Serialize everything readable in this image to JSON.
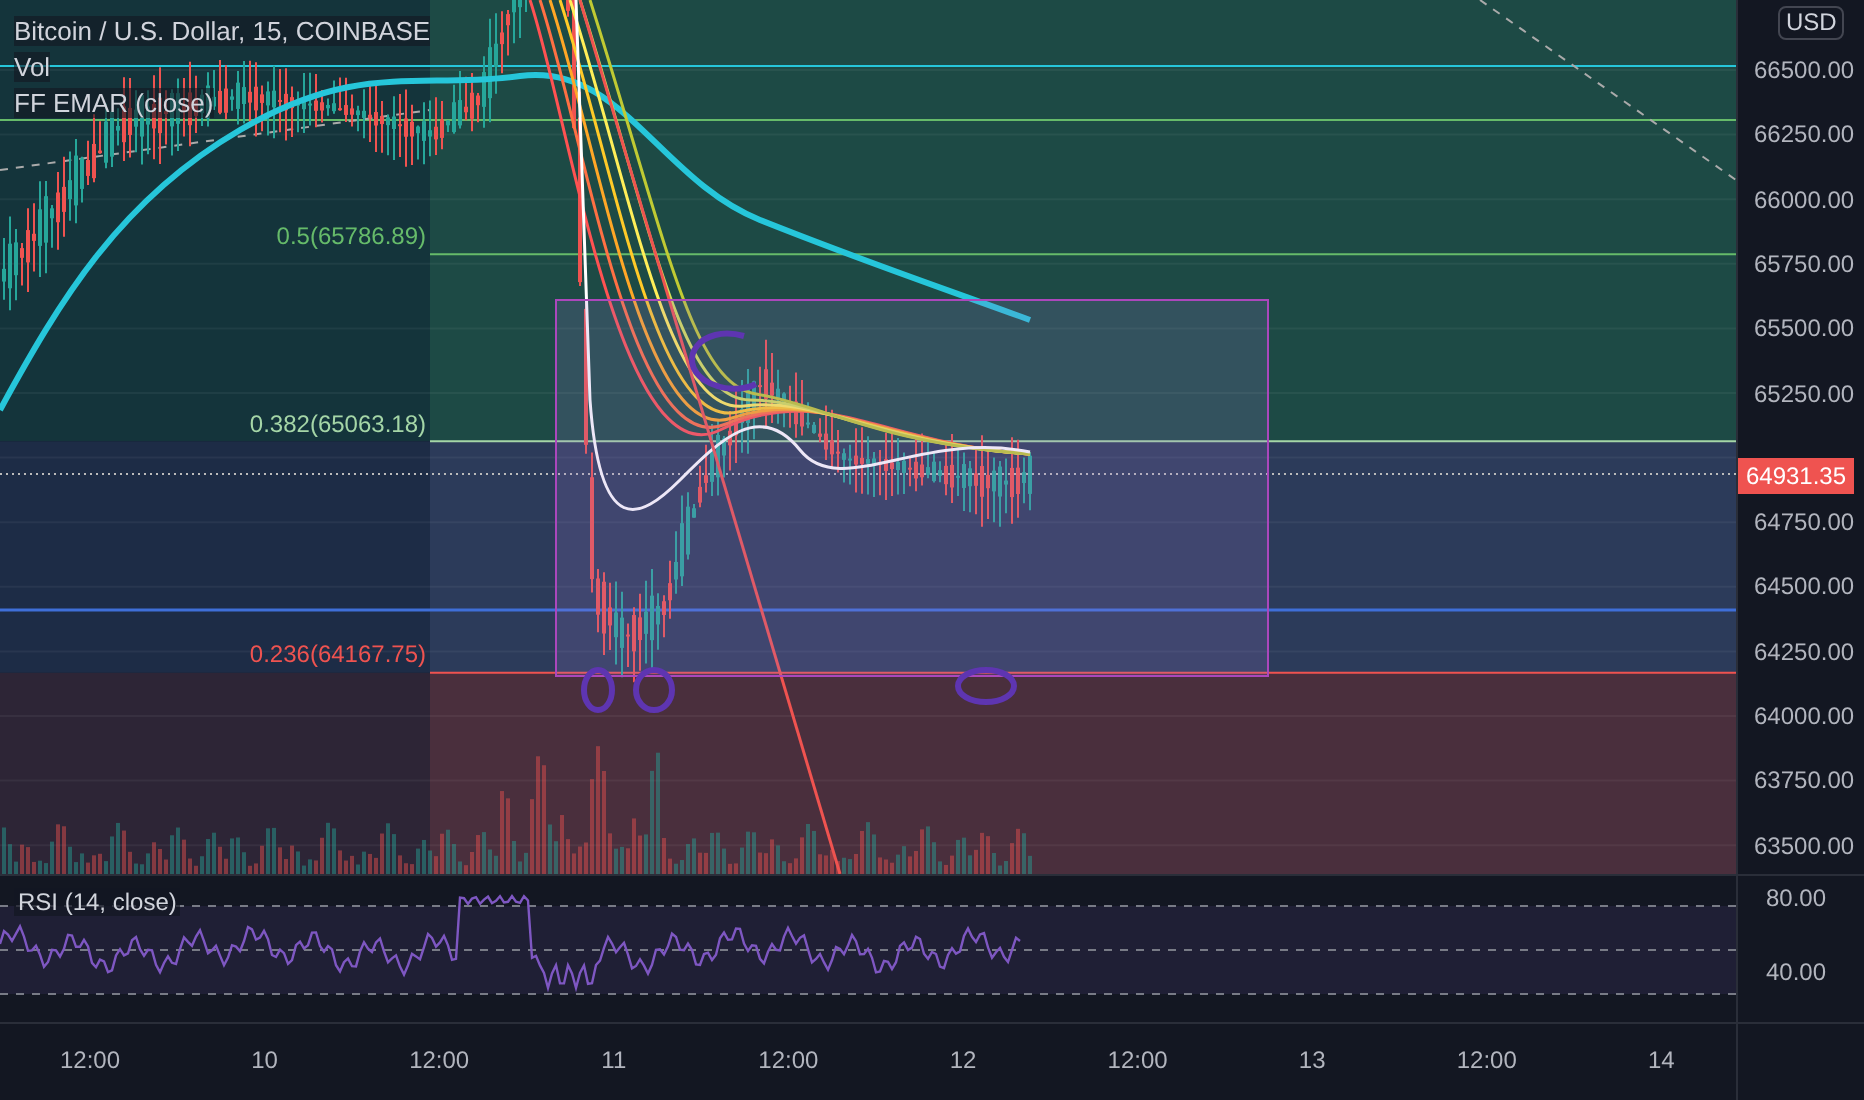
{
  "legend": [
    "Bitcoin / U.S. Dollar, 15, COINBASE",
    "Vol",
    "FF EMAR (close)"
  ],
  "currency": "USD",
  "price_axis": [
    "66500.00",
    "66250.00",
    "66000.00",
    "65750.00",
    "65500.00",
    "65250.00",
    "64750.00",
    "64500.00",
    "64250.00",
    "64000.00",
    "63750.00",
    "63500.00"
  ],
  "last_price": "64931.35",
  "fib_levels": [
    {
      "label": "0.5(65786.89)",
      "color": "#66bb6a"
    },
    {
      "label": "0.382(65063.18)",
      "color": "#a5d6a7"
    },
    {
      "label": "0.236(64167.75)",
      "color": "#ef5350"
    }
  ],
  "rsi": {
    "title": "RSI (14, close)",
    "axis": [
      "80.00",
      "40.00"
    ]
  },
  "time_axis": [
    "12:00",
    "10",
    "12:00",
    "11",
    "12:00",
    "12",
    "12:00",
    "13",
    "12:00",
    "14"
  ]
}
